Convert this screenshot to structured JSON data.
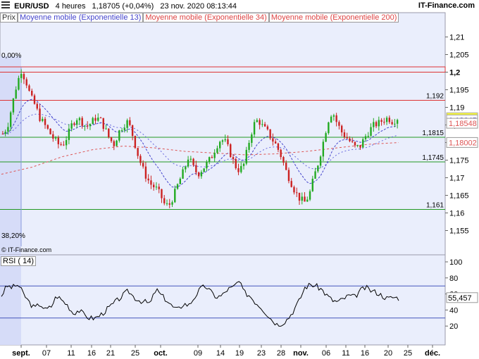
{
  "header": {
    "symbol": "EUR/USD",
    "period": "4 heures",
    "last": "1,18705 (+0,04%)",
    "datetime": "23 nov. 2020 08:13:44",
    "site": "IT-Finance.com"
  },
  "legend": {
    "price": "Prix",
    "ma13": "Moyenne mobile (Exponentielle 13)",
    "ma34": "Moyenne mobile (Exponentielle 34)",
    "ma200": "Moyenne mobile (Exponentielle 200)"
  },
  "watermark": "© IT-Finance.com",
  "fib": {
    "top_label": "0,00%",
    "bottom_label": "38,20%"
  },
  "colors": {
    "up": "#22aa22",
    "down": "#cc2222",
    "ma13": "#4444cc",
    "ma34": "#6666dd",
    "ma200": "#dd5555",
    "resistance": "#dd3333",
    "support": "#229922",
    "last_price_bg": "#ffff33",
    "panel_bg": "#eaeefc",
    "shade": "#d6dcf8"
  },
  "chart_data": [
    {
      "type": "candlestick",
      "title": "EUR/USD 4 heures",
      "y_ticks": [
        "1,21",
        "1,205",
        "1,2",
        "1,195",
        "1,19",
        "1,185",
        "1,18",
        "1,175",
        "1,17",
        "1,165",
        "1,16",
        "1,155"
      ],
      "ylim": [
        1.1505,
        1.2125
      ],
      "x_ticks": [
        "sept.",
        "07",
        "11",
        "16",
        "21",
        "25",
        "oct.",
        "09",
        "14",
        "19",
        "23",
        "28",
        "nov.",
        "06",
        "11",
        "16",
        "20",
        "25",
        "déc."
      ],
      "levels": [
        {
          "label": "1,2",
          "value": 1.2,
          "kind": "resistance"
        },
        {
          "label": "1,192",
          "value": 1.192,
          "kind": "resistance"
        },
        {
          "label": "1,1815",
          "value": 1.1815,
          "kind": "support"
        },
        {
          "label": "1,1745",
          "value": 1.1745,
          "kind": "support"
        },
        {
          "label": "1,161",
          "value": 1.161,
          "kind": "support"
        }
      ],
      "price_labels": [
        {
          "label": "1,18705",
          "value": 1.18705,
          "kind": "last"
        },
        {
          "label": "1,18645",
          "value": 1.18645,
          "kind": "ma13"
        },
        {
          "label": "1,18548",
          "value": 1.18548,
          "kind": "ma34"
        },
        {
          "label": "1,18002",
          "value": 1.18002,
          "kind": "ma200"
        }
      ],
      "close_path": [
        1.1825,
        1.1845,
        1.1905,
        1.1965,
        1.2005,
        1.1975,
        1.193,
        1.1905,
        1.187,
        1.185,
        1.183,
        1.181,
        1.1795,
        1.1795,
        1.182,
        1.1855,
        1.187,
        1.186,
        1.1845,
        1.1855,
        1.187,
        1.1865,
        1.184,
        1.181,
        1.1795,
        1.183,
        1.185,
        1.186,
        1.182,
        1.177,
        1.173,
        1.17,
        1.168,
        1.167,
        1.165,
        1.162,
        1.1625,
        1.1655,
        1.169,
        1.172,
        1.176,
        1.173,
        1.171,
        1.1725,
        1.174,
        1.176,
        1.179,
        1.181,
        1.18,
        1.177,
        1.1735,
        1.172,
        1.174,
        1.18,
        1.185,
        1.1865,
        1.1845,
        1.183,
        1.181,
        1.179,
        1.176,
        1.172,
        1.169,
        1.166,
        1.164,
        1.163,
        1.165,
        1.17,
        1.1745,
        1.18,
        1.186,
        1.189,
        1.1855,
        1.183,
        1.1815,
        1.18,
        1.1785,
        1.179,
        1.1815,
        1.1835,
        1.185,
        1.1855,
        1.1865,
        1.187,
        1.186,
        1.187
      ],
      "ma200_path": [
        1.171,
        1.173,
        1.176,
        1.178,
        1.179,
        1.1785,
        1.1775,
        1.177,
        1.1765,
        1.1768,
        1.1775,
        1.1785,
        1.1795,
        1.18
      ]
    },
    {
      "type": "line",
      "title": "RSI ( 14)",
      "value_label": "55,457",
      "y_ticks": [
        "100",
        "80",
        "60",
        "40",
        "20"
      ],
      "ylim": [
        0,
        100
      ],
      "bands": [
        70,
        30
      ],
      "values": [
        58,
        70,
        68,
        72,
        60,
        50,
        42,
        48,
        40,
        44,
        58,
        52,
        46,
        36,
        40,
        34,
        30,
        30,
        34,
        40,
        46,
        52,
        58,
        64,
        56,
        52,
        50,
        48,
        66,
        58,
        52,
        44,
        40,
        48,
        46,
        56,
        66,
        70,
        62,
        56,
        58,
        66,
        68,
        76,
        62,
        58,
        50,
        44,
        36,
        28,
        22,
        24,
        30,
        40,
        52,
        68,
        72,
        70,
        66,
        58,
        52,
        50,
        54,
        58,
        56,
        64,
        68,
        64,
        62,
        58,
        54,
        56,
        55
      ]
    }
  ]
}
